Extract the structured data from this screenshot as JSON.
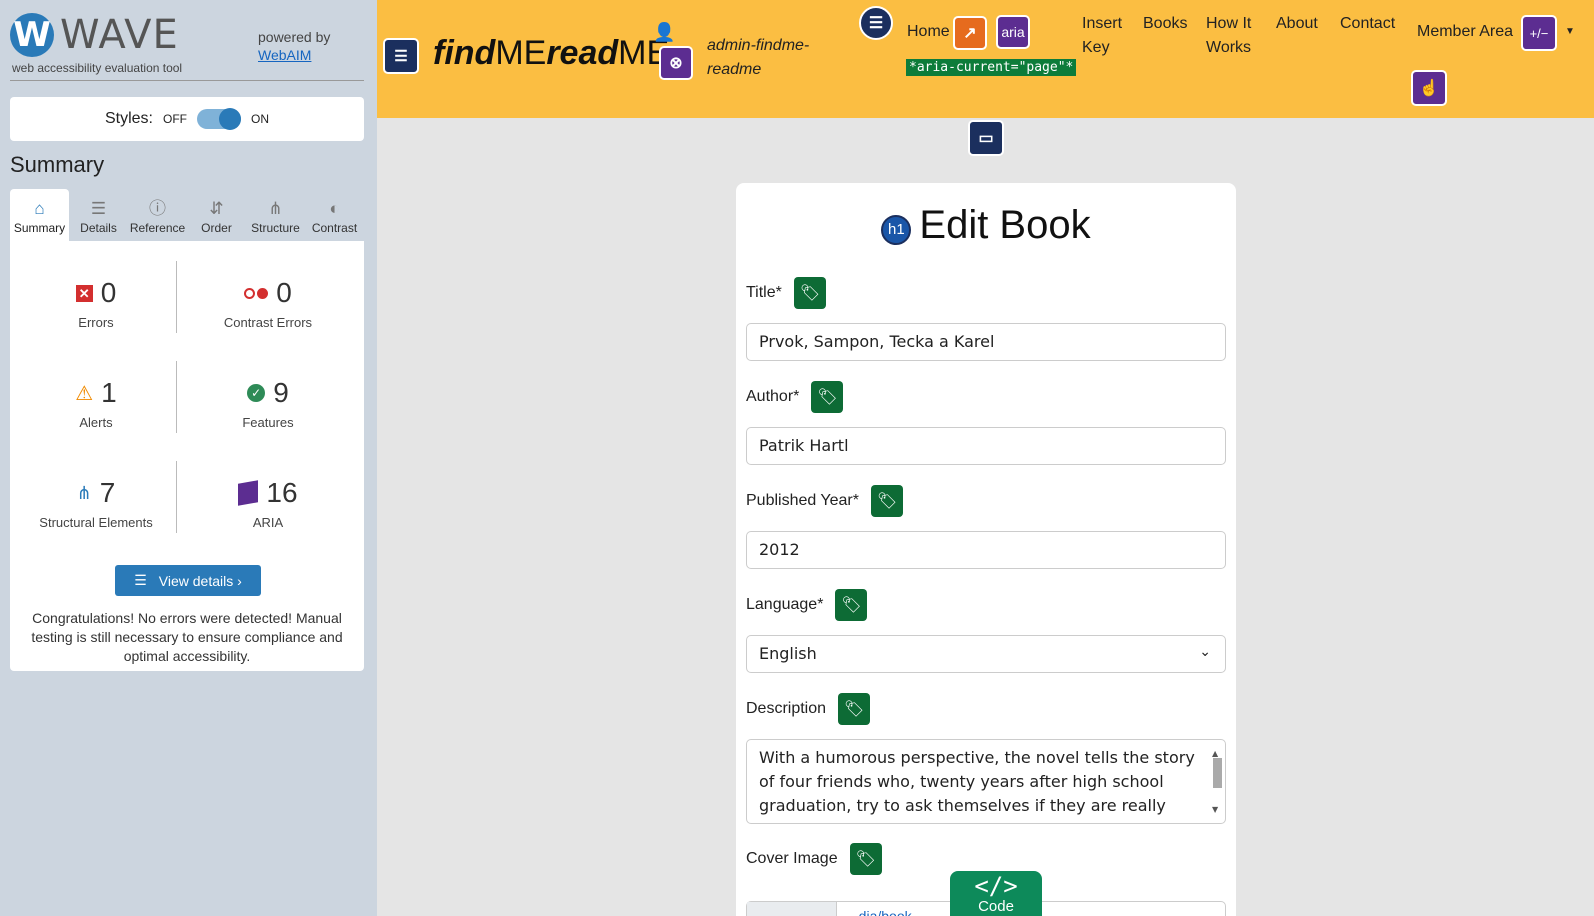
{
  "wave": {
    "logo_letter": "W",
    "logo_text": "WAVE",
    "tagline": "web accessibility evaluation tool",
    "powered_by": "powered by",
    "webaim_link": "WebAIM",
    "styles_label": "Styles:",
    "styles_off": "OFF",
    "styles_on": "ON",
    "summary_heading": "Summary",
    "tabs": [
      {
        "label": "Summary",
        "icon": "home-icon",
        "glyph": "⌂"
      },
      {
        "label": "Details",
        "icon": "list-icon",
        "glyph": "☰"
      },
      {
        "label": "Reference",
        "icon": "info-icon",
        "glyph": "ⓘ"
      },
      {
        "label": "Order",
        "icon": "order-icon",
        "glyph": "⇵"
      },
      {
        "label": "Structure",
        "icon": "structure-icon",
        "glyph": "⋔"
      },
      {
        "label": "Contrast",
        "icon": "contrast-icon",
        "glyph": "◐"
      }
    ],
    "stats": {
      "errors": {
        "count": "0",
        "label": "Errors"
      },
      "contrast_errors": {
        "count": "0",
        "label": "Contrast Errors"
      },
      "alerts": {
        "count": "1",
        "label": "Alerts"
      },
      "features": {
        "count": "9",
        "label": "Features"
      },
      "structural": {
        "count": "7",
        "label": "Structural Elements"
      },
      "aria": {
        "count": "16",
        "label": "ARIA"
      }
    },
    "view_details": "View details ›",
    "congrats": "Congratulations! No errors were detected! Manual testing is still necessary to ensure compliance and optimal accessibility."
  },
  "site": {
    "brand_find": "find",
    "brand_me1": "ME",
    "brand_read": "read",
    "brand_me2": "ME",
    "username": "admin-findme-readme",
    "nav": {
      "home": "Home",
      "insert": "Insert Key",
      "books": "Books",
      "how": "How It Works",
      "about": "About",
      "contact": "Contact",
      "member": "Member Area"
    },
    "aria_current": "*aria-current=\"page\"*",
    "aria_badge": "aria",
    "plusminus_badge": "+/−"
  },
  "form": {
    "heading": "Edit Book",
    "h1_badge": "h1",
    "title_label": "Title*",
    "title_value": "Prvok, Sampon, Tecka a Karel",
    "author_label": "Author*",
    "author_value": "Patrik Hartl",
    "year_label": "Published Year*",
    "year_value": "2012",
    "language_label": "Language*",
    "language_value": "English",
    "description_label": "Description",
    "description_value": "With a humorous perspective, the novel tells the story of four friends who, twenty years after high school graduation, try to ask themselves if they are really living the way they",
    "cover_label": "Cover Image",
    "cover_path": "...dia/book..."
  },
  "code_tab": {
    "symbol": "</>",
    "label": "Code"
  },
  "colors": {
    "header_bg": "#fbbe42",
    "wave_blue": "#2a7ab8",
    "tag_green": "#0d6b35",
    "aria_purple": "#5c2d91"
  }
}
